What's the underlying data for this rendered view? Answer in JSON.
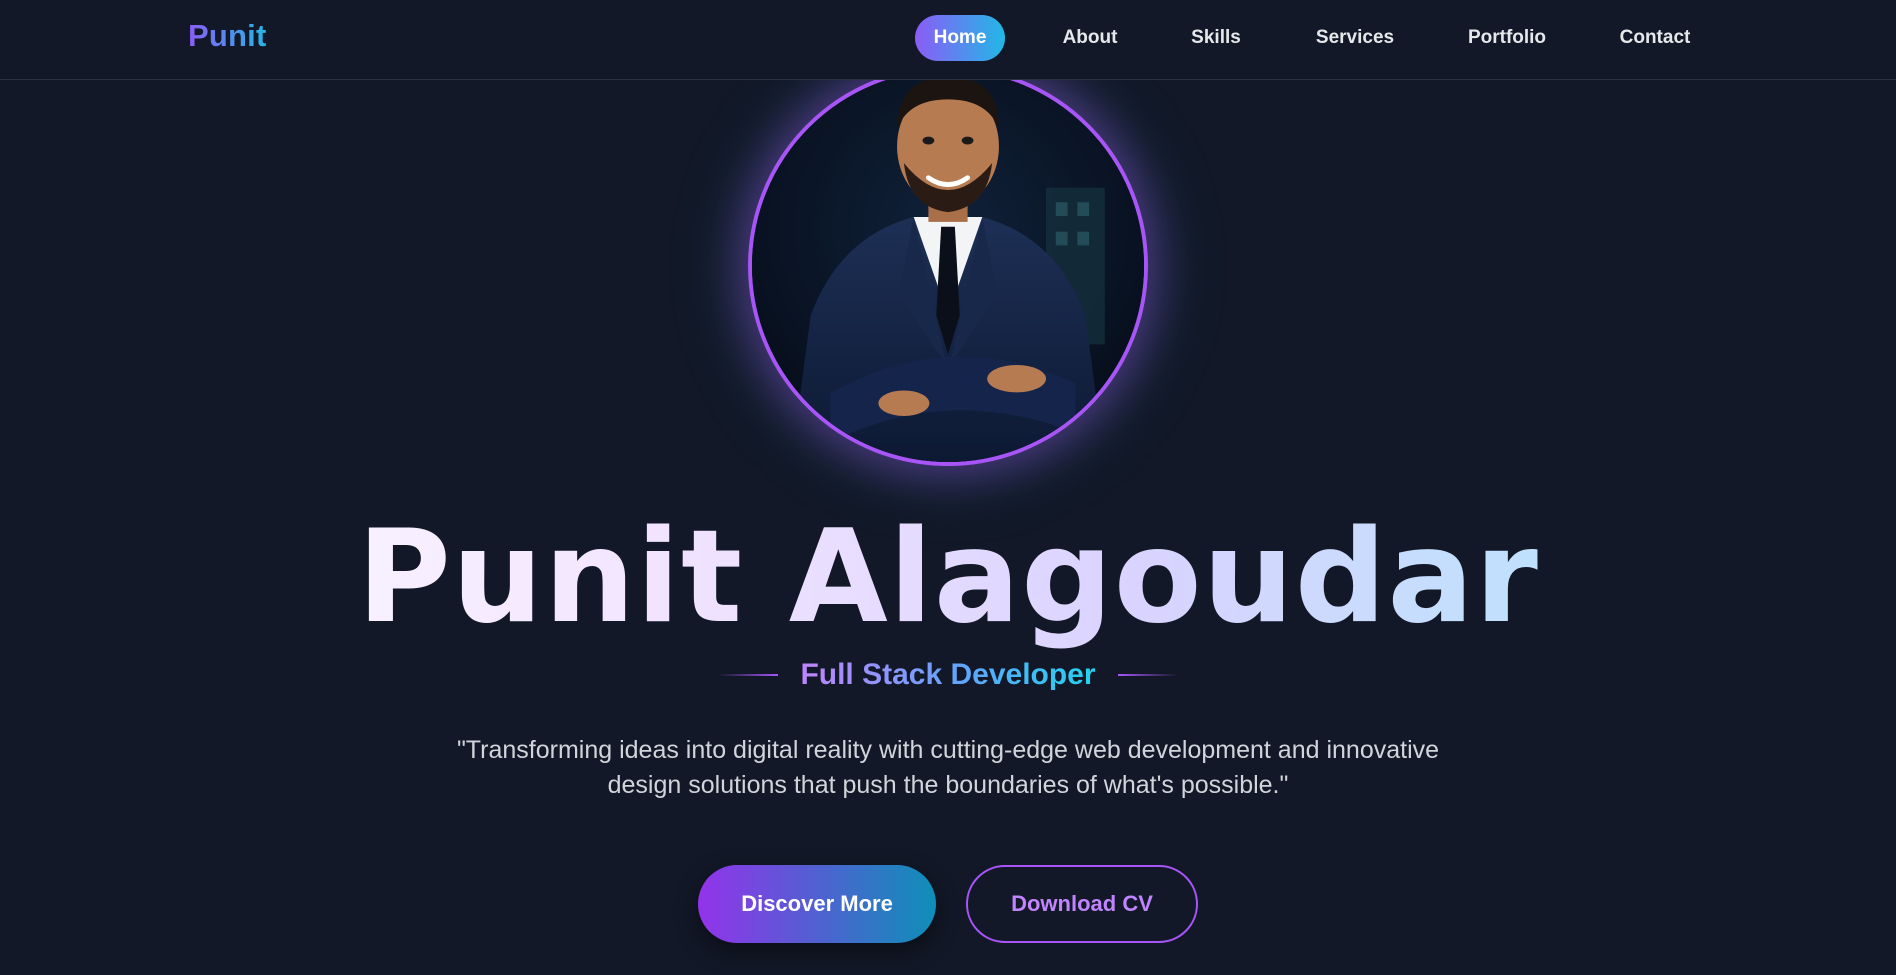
{
  "brand": {
    "logo_text": "Punit"
  },
  "nav": {
    "items": [
      {
        "label": "Home",
        "active": true
      },
      {
        "label": "About",
        "active": false
      },
      {
        "label": "Skills",
        "active": false
      },
      {
        "label": "Services",
        "active": false
      },
      {
        "label": "Portfolio",
        "active": false
      },
      {
        "label": "Contact",
        "active": false
      }
    ]
  },
  "hero": {
    "name": "Punit Alagoudar",
    "role": "Full Stack Developer",
    "quote": "\"Transforming ideas into digital reality with cutting-edge web development and innovative design solutions that push the boundaries of what's possible.\"",
    "primary_button": "Discover More",
    "secondary_button": "Download CV"
  },
  "colors": {
    "background": "#121827",
    "accent_purple": "#a855f7",
    "accent_cyan": "#22b8e6"
  }
}
